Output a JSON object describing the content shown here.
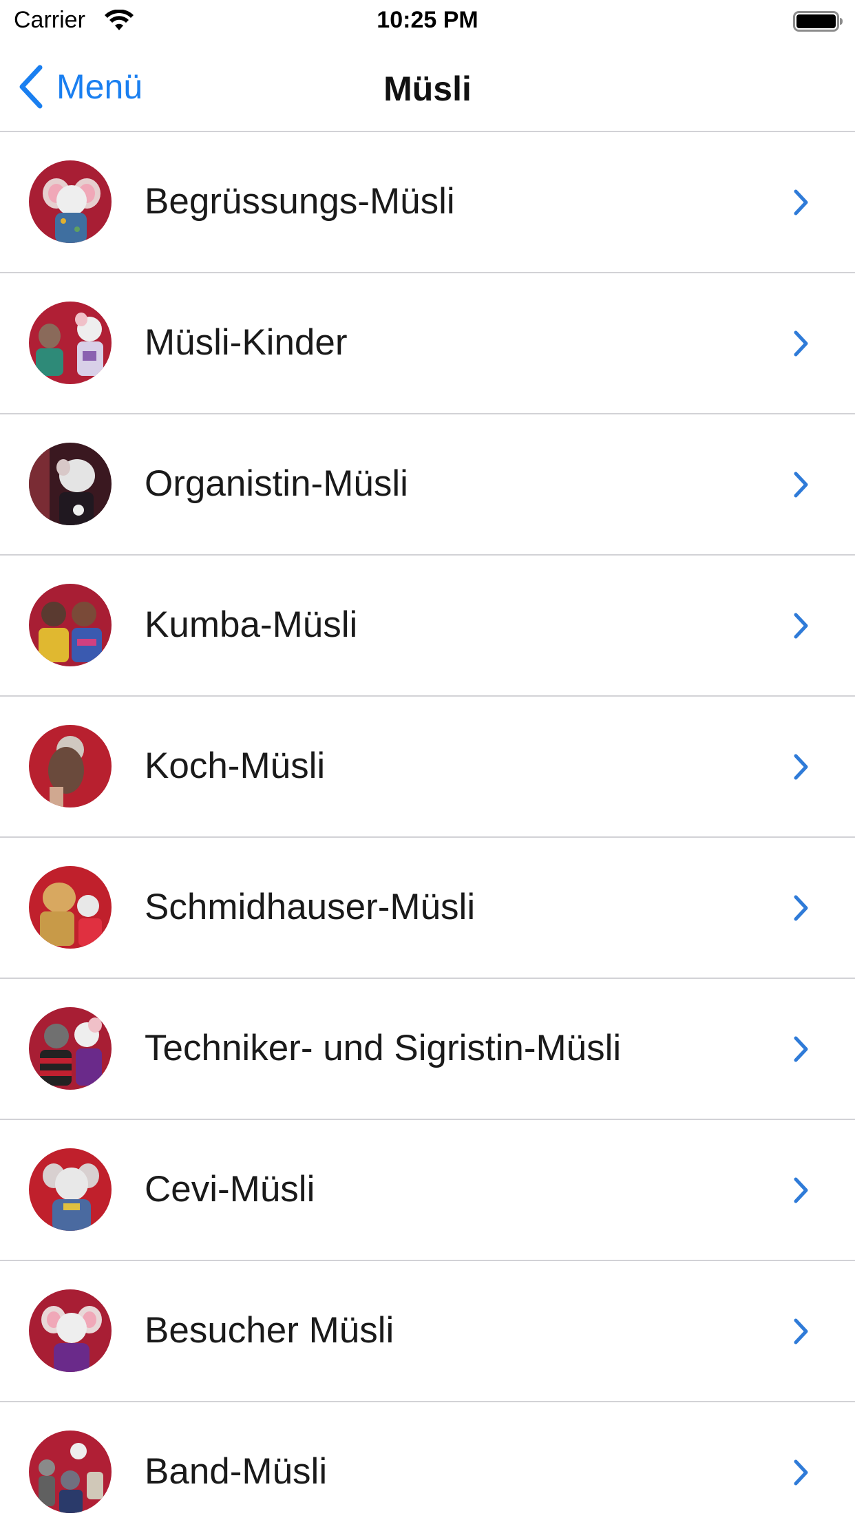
{
  "status_bar": {
    "carrier": "Carrier",
    "time": "10:25 PM",
    "wifi_icon": "wifi-icon",
    "battery_icon": "battery-icon"
  },
  "nav": {
    "back_label": "Menü",
    "title": "Müsli",
    "back_icon": "chevron-left-icon"
  },
  "colors": {
    "accent": "#1a7ff0",
    "chevron": "#2f7bd8",
    "separator": "#d2d2d6"
  },
  "items": [
    {
      "label": "Begrüssungs-Müsli",
      "icon": "chevron-right-icon"
    },
    {
      "label": "Müsli-Kinder",
      "icon": "chevron-right-icon"
    },
    {
      "label": "Organistin-Müsli",
      "icon": "chevron-right-icon"
    },
    {
      "label": "Kumba-Müsli",
      "icon": "chevron-right-icon"
    },
    {
      "label": "Koch-Müsli",
      "icon": "chevron-right-icon"
    },
    {
      "label": "Schmidhauser-Müsli",
      "icon": "chevron-right-icon"
    },
    {
      "label": "Techniker- und Sigristin-Müsli",
      "icon": "chevron-right-icon"
    },
    {
      "label": "Cevi-Müsli",
      "icon": "chevron-right-icon"
    },
    {
      "label": "Besucher Müsli",
      "icon": "chevron-right-icon"
    },
    {
      "label": "Band-Müsli",
      "icon": "chevron-right-icon"
    }
  ]
}
